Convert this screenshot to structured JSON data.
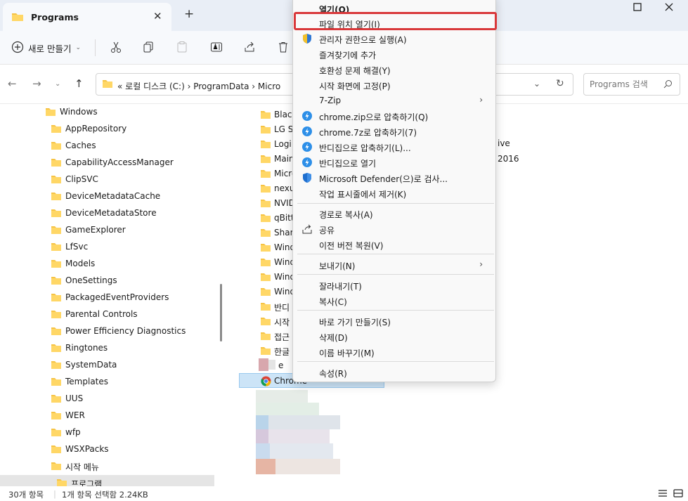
{
  "window": {
    "tab_title": "Programs",
    "new_tab": "+",
    "close_tab": "✕"
  },
  "toolbar": {
    "new_label": "새로 만들기"
  },
  "address": {
    "path": "« 로컬 디스크 (C:)  ›  ProgramData  ›  Micro",
    "search_placeholder": "Programs 검색"
  },
  "tree": {
    "items": [
      "Windows",
      "AppRepository",
      "Caches",
      "CapabilityAccessManager",
      "ClipSVC",
      "DeviceMetadataCache",
      "DeviceMetadataStore",
      "GameExplorer",
      "LfSvc",
      "Models",
      "OneSettings",
      "PackagedEventProviders",
      "Parental Controls",
      "Power Efficiency Diagnostics",
      "Ringtones",
      "SystemData",
      "Templates",
      "UUS",
      "WER",
      "wfp",
      "WSXPacks",
      "시작 메뉴",
      "프로그램"
    ]
  },
  "files": {
    "items": [
      "Black",
      "LG S",
      "Logi",
      "Main",
      "Micro",
      "nexu",
      "NVID",
      "qBitt",
      "Share",
      "Wind",
      "Wind",
      "Wind",
      "Wind",
      "반디",
      "시작",
      "접근",
      "한글",
      "e"
    ],
    "selected": "Chrome",
    "side_text_1": "ive",
    "side_text_2": "2016"
  },
  "context_menu": {
    "items": [
      "열기(O)",
      "파일 위치 열기(I)",
      "관리자 권한으로 실행(A)",
      "즐겨찾기에 추가",
      "호환성 문제 해결(Y)",
      "시작 화면에 고정(P)",
      "7-Zip",
      "chrome.zip으로 압축하기(Q)",
      "chrome.7z로 압축하기(7)",
      "반디집으로 압축하기(L)...",
      "반디집으로 열기",
      "Microsoft Defender(으)로 검사...",
      "작업 표시줄에서 제거(K)",
      "경로로 복사(A)",
      "공유",
      "이전 버전 복원(V)",
      "보내기(N)",
      "잘라내기(T)",
      "복사(C)",
      "바로 가기 만들기(S)",
      "삭제(D)",
      "이름 바꾸기(M)",
      "속성(R)"
    ],
    "arrow": "›"
  },
  "status": {
    "count": "30개 항목",
    "selection": "1개 항목 선택함 2.24KB"
  },
  "colors": {
    "accent": "#0067c0",
    "highlight_border": "#d9383a",
    "folder": "#f6c344",
    "selection_bg": "#cce4f7"
  }
}
